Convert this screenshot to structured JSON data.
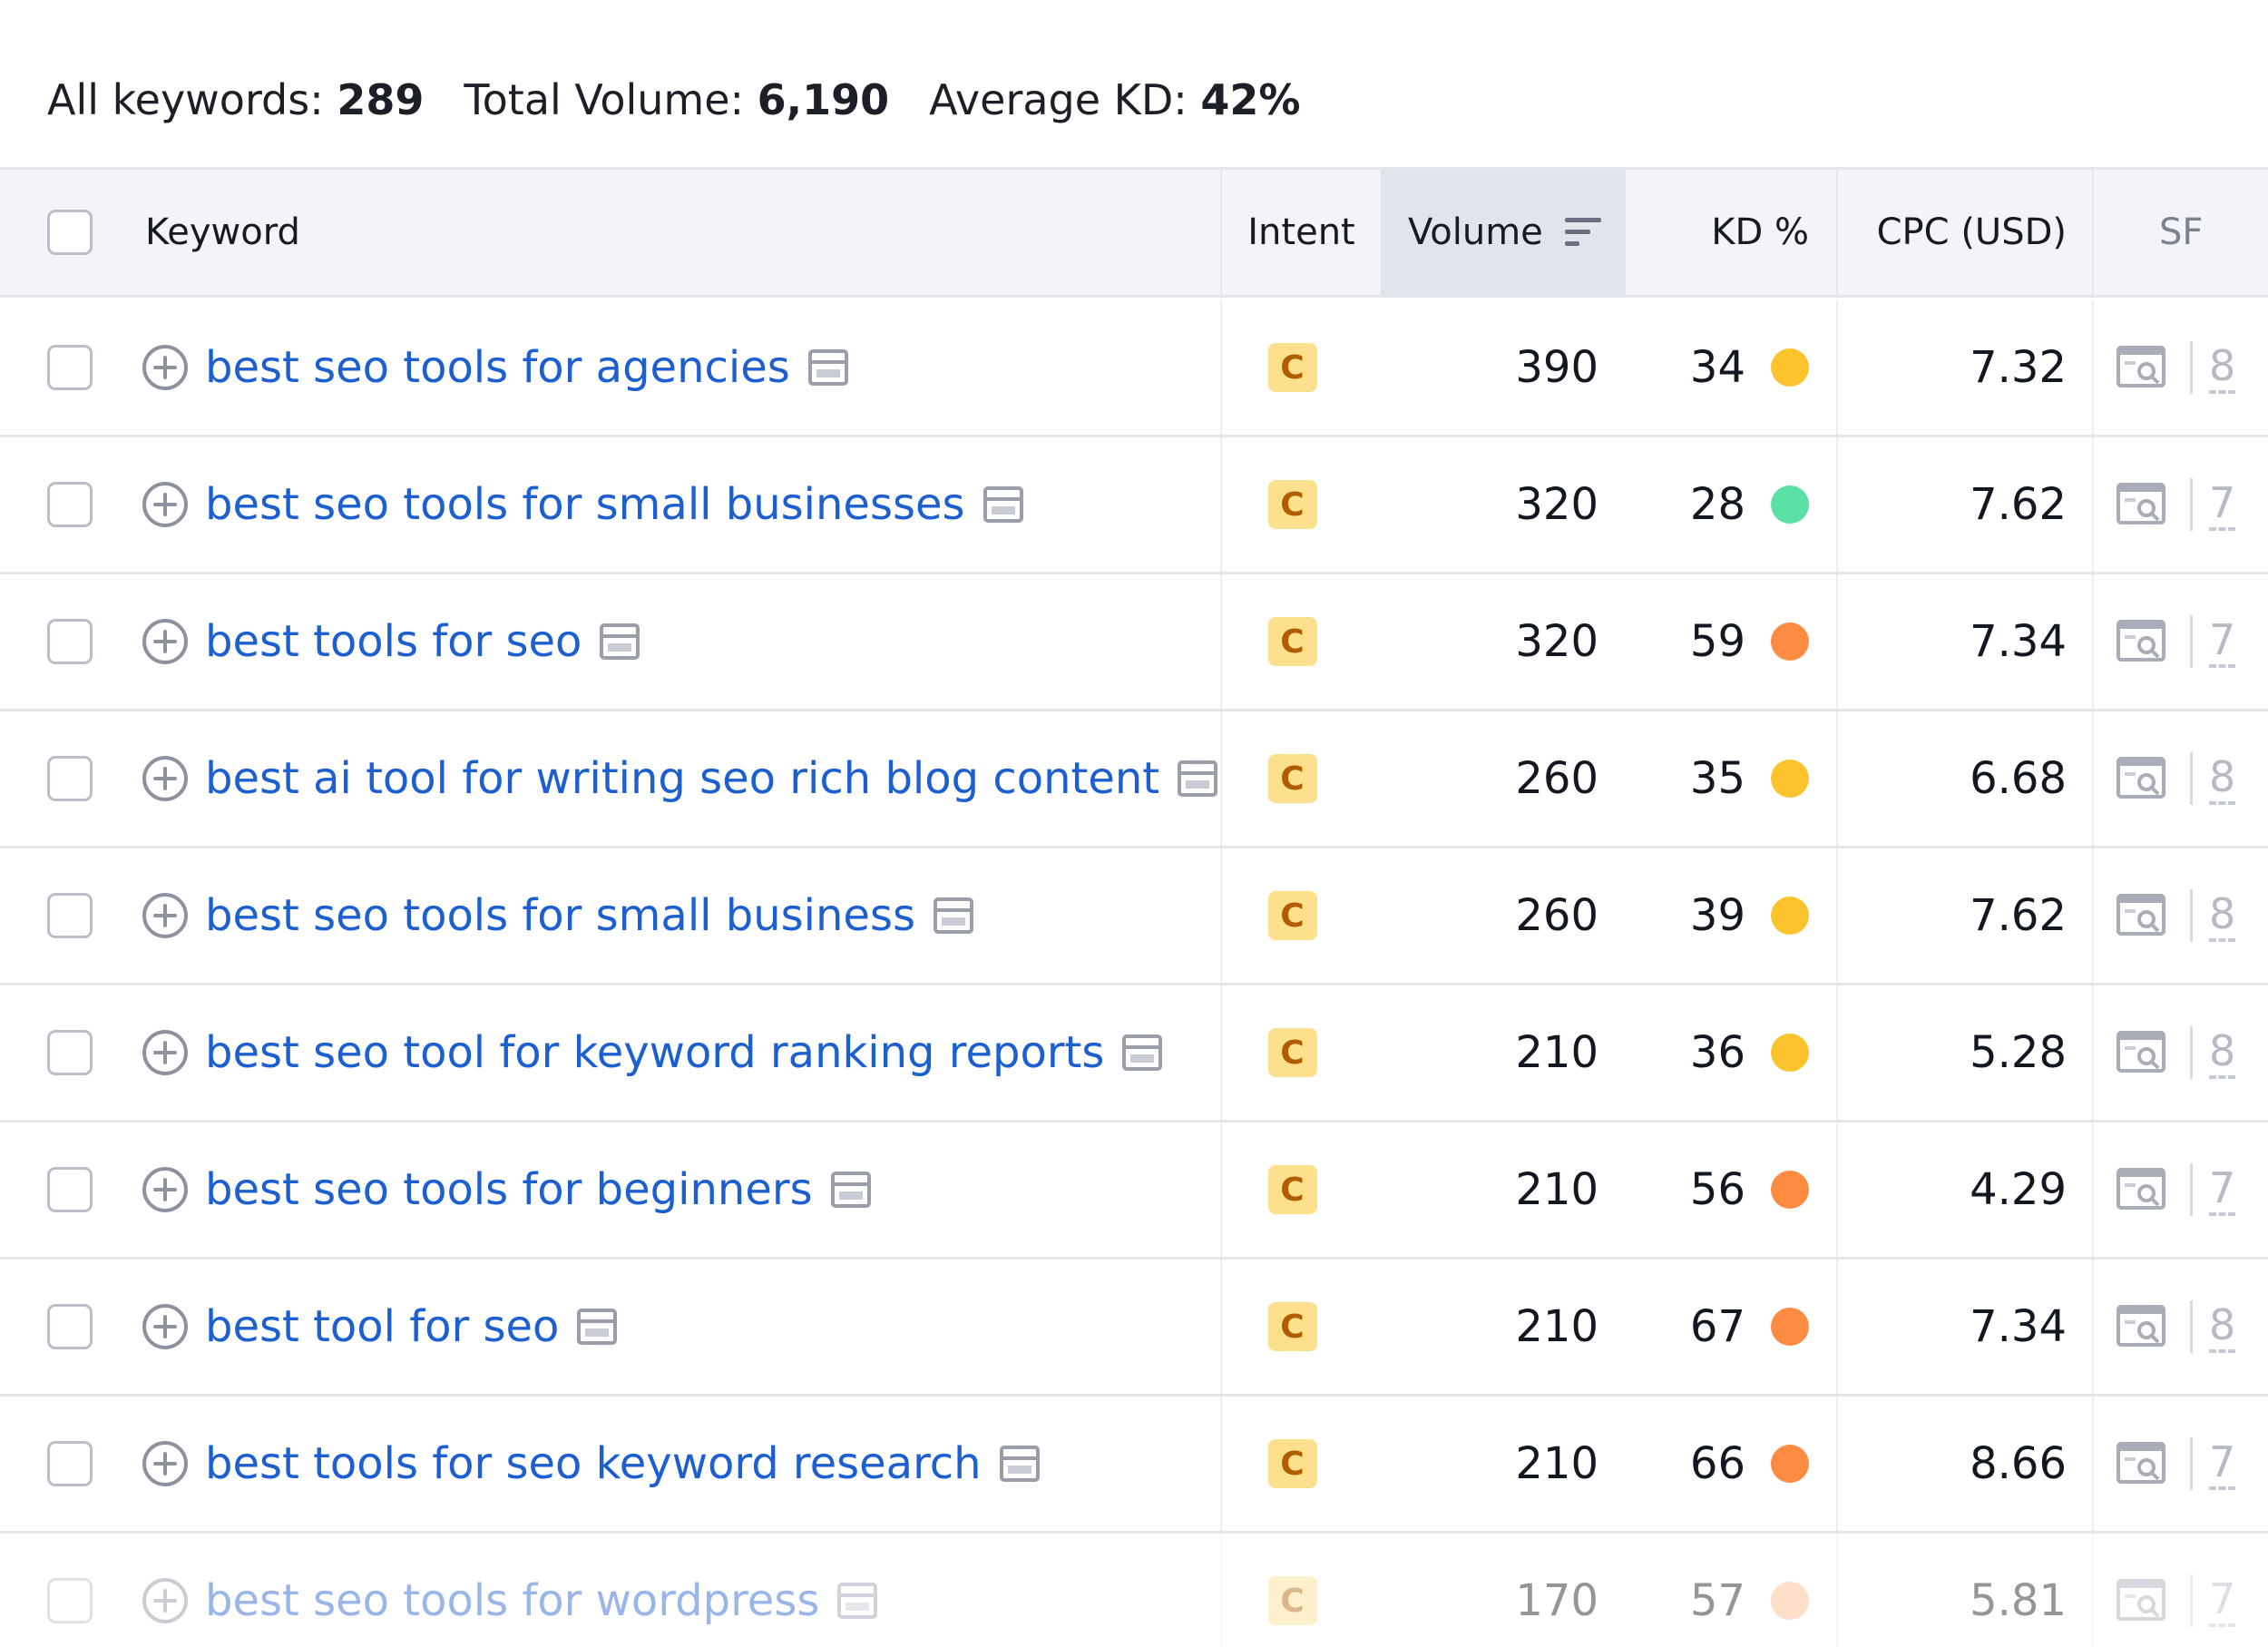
{
  "summary": {
    "all_keywords_label": "All keywords:",
    "all_keywords_value": "289",
    "total_volume_label": "Total Volume:",
    "total_volume_value": "6,190",
    "avg_kd_label": "Average KD:",
    "avg_kd_value": "42%"
  },
  "columns": {
    "keyword": "Keyword",
    "intent": "Intent",
    "volume": "Volume",
    "kd": "KD %",
    "cpc": "CPC (USD)",
    "sf": "SF"
  },
  "colors": {
    "link": "#1c5fd0",
    "kd_yellow": "#fcc32c",
    "kd_green": "#59e0a2",
    "kd_orange": "#fd8b42",
    "kd_light_orange": "#fbb98c",
    "intent_bg": "#fde08b",
    "intent_text": "#b15c00"
  },
  "icons": {
    "add": "plus-circle-icon",
    "serp": "serp-window-icon",
    "sort": "sort-descending-icon",
    "sf": "serp-features-icon"
  },
  "rows": [
    {
      "keyword": "best seo tools for agencies",
      "intent": "C",
      "volume": "390",
      "kd": "34",
      "kd_color": "#fcc32c",
      "cpc": "7.32",
      "sf": "8"
    },
    {
      "keyword": "best seo tools for small businesses",
      "intent": "C",
      "volume": "320",
      "kd": "28",
      "kd_color": "#59e0a2",
      "cpc": "7.62",
      "sf": "7"
    },
    {
      "keyword": "best tools for seo",
      "intent": "C",
      "volume": "320",
      "kd": "59",
      "kd_color": "#fd8b42",
      "cpc": "7.34",
      "sf": "7"
    },
    {
      "keyword": "best ai tool for writing seo rich blog content",
      "intent": "C",
      "volume": "260",
      "kd": "35",
      "kd_color": "#fcc32c",
      "cpc": "6.68",
      "sf": "8"
    },
    {
      "keyword": "best seo tools for small business",
      "intent": "C",
      "volume": "260",
      "kd": "39",
      "kd_color": "#fcc32c",
      "cpc": "7.62",
      "sf": "8"
    },
    {
      "keyword": "best seo tool for keyword ranking reports",
      "intent": "C",
      "volume": "210",
      "kd": "36",
      "kd_color": "#fcc32c",
      "cpc": "5.28",
      "sf": "8"
    },
    {
      "keyword": "best seo tools for beginners",
      "intent": "C",
      "volume": "210",
      "kd": "56",
      "kd_color": "#fd8b42",
      "cpc": "4.29",
      "sf": "7"
    },
    {
      "keyword": "best tool for seo",
      "intent": "C",
      "volume": "210",
      "kd": "67",
      "kd_color": "#fd8b42",
      "cpc": "7.34",
      "sf": "8"
    },
    {
      "keyword": "best tools for seo keyword research",
      "intent": "C",
      "volume": "210",
      "kd": "66",
      "kd_color": "#fd8b42",
      "cpc": "8.66",
      "sf": "7"
    },
    {
      "keyword": "best seo tools for wordpress",
      "intent": "C",
      "volume": "170",
      "kd": "57",
      "kd_color": "#fbb98c",
      "cpc": "5.81",
      "sf": "7"
    }
  ]
}
